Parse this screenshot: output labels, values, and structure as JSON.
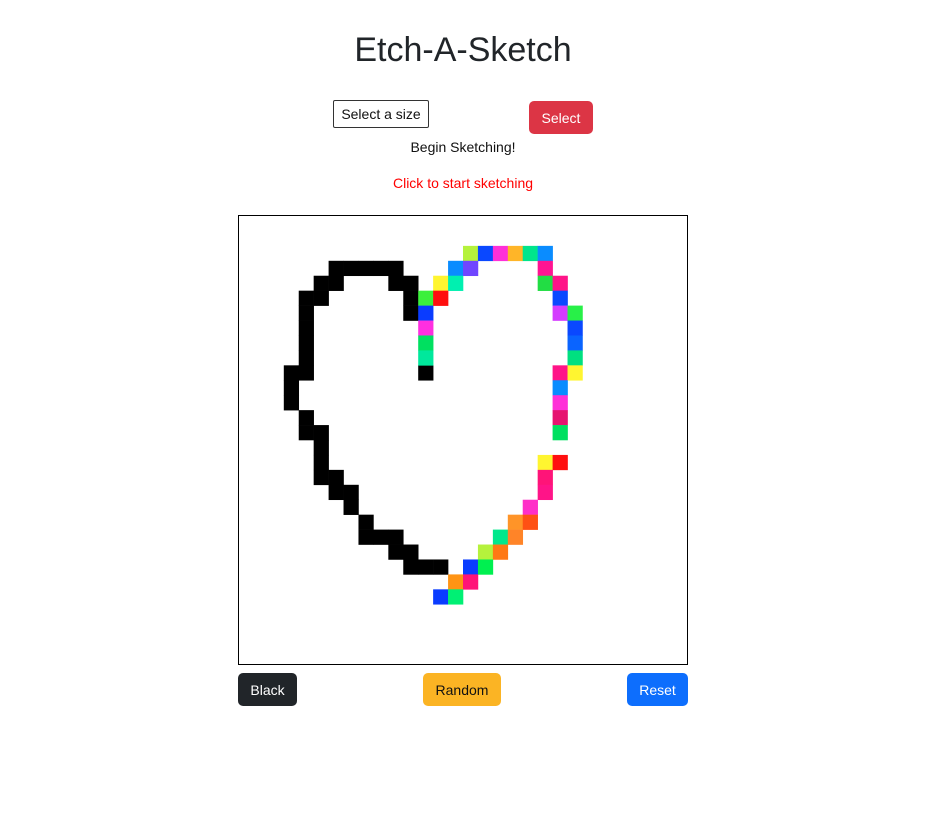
{
  "title": "Etch-A-Sketch",
  "controls": {
    "size_select_label": "Select a size",
    "select_button": "Select"
  },
  "status": "Begin Sketching!",
  "hint": "Click to start sketching",
  "hint_color": "#ff0000",
  "buttons": {
    "black": "Black",
    "random": "Random",
    "reset": "Reset"
  },
  "button_colors": {
    "select": "#dc3545",
    "black": "#212529",
    "random": "#fbb424",
    "reset": "#0d6efd"
  },
  "sketch": {
    "cells_per_side": 30,
    "black_cells": [
      [
        6,
        3
      ],
      [
        7,
        3
      ],
      [
        8,
        3
      ],
      [
        9,
        3
      ],
      [
        10,
        3
      ],
      [
        5,
        4
      ],
      [
        6,
        4
      ],
      [
        10,
        4
      ],
      [
        11,
        4
      ],
      [
        4,
        5
      ],
      [
        5,
        5
      ],
      [
        11,
        5
      ],
      [
        4,
        6
      ],
      [
        11,
        6
      ],
      [
        4,
        7
      ],
      [
        4,
        8
      ],
      [
        4,
        9
      ],
      [
        3,
        10
      ],
      [
        4,
        10
      ],
      [
        3,
        11
      ],
      [
        3,
        12
      ],
      [
        4,
        13
      ],
      [
        4,
        14
      ],
      [
        5,
        14
      ],
      [
        5,
        15
      ],
      [
        5,
        16
      ],
      [
        5,
        17
      ],
      [
        6,
        17
      ],
      [
        6,
        18
      ],
      [
        7,
        18
      ],
      [
        7,
        19
      ],
      [
        8,
        20
      ],
      [
        8,
        21
      ],
      [
        9,
        21
      ],
      [
        10,
        21
      ],
      [
        10,
        22
      ],
      [
        11,
        22
      ],
      [
        11,
        23
      ],
      [
        12,
        23
      ],
      [
        13,
        23
      ],
      [
        12,
        10
      ]
    ],
    "colored_cells": [
      {
        "c": 15,
        "r": 2,
        "color": "#b5f23c"
      },
      {
        "c": 16,
        "r": 2,
        "color": "#0a48ff"
      },
      {
        "c": 17,
        "r": 2,
        "color": "#ff2fd8"
      },
      {
        "c": 18,
        "r": 2,
        "color": "#ffb528"
      },
      {
        "c": 19,
        "r": 2,
        "color": "#00e58c"
      },
      {
        "c": 20,
        "r": 2,
        "color": "#0a8cff"
      },
      {
        "c": 14,
        "r": 3,
        "color": "#0a8cff"
      },
      {
        "c": 15,
        "r": 3,
        "color": "#7045ff"
      },
      {
        "c": 20,
        "r": 3,
        "color": "#ff1492"
      },
      {
        "c": 13,
        "r": 4,
        "color": "#fff530"
      },
      {
        "c": 14,
        "r": 4,
        "color": "#00f0b0"
      },
      {
        "c": 20,
        "r": 4,
        "color": "#22dd44"
      },
      {
        "c": 21,
        "r": 4,
        "color": "#ff1488"
      },
      {
        "c": 12,
        "r": 5,
        "color": "#3cf03c"
      },
      {
        "c": 13,
        "r": 5,
        "color": "#ff0f0f"
      },
      {
        "c": 21,
        "r": 5,
        "color": "#0a48ff"
      },
      {
        "c": 12,
        "r": 6,
        "color": "#0a3cff"
      },
      {
        "c": 21,
        "r": 6,
        "color": "#d43cff"
      },
      {
        "c": 22,
        "r": 6,
        "color": "#28f048"
      },
      {
        "c": 12,
        "r": 7,
        "color": "#ff2fe0"
      },
      {
        "c": 22,
        "r": 7,
        "color": "#0a48ff"
      },
      {
        "c": 12,
        "r": 8,
        "color": "#00e060"
      },
      {
        "c": 22,
        "r": 8,
        "color": "#0a64ff"
      },
      {
        "c": 12,
        "r": 9,
        "color": "#00e89c"
      },
      {
        "c": 22,
        "r": 9,
        "color": "#00e080"
      },
      {
        "c": 21,
        "r": 10,
        "color": "#ff1488"
      },
      {
        "c": 22,
        "r": 10,
        "color": "#fff530"
      },
      {
        "c": 21,
        "r": 11,
        "color": "#0a8cff"
      },
      {
        "c": 21,
        "r": 12,
        "color": "#ff2fd8"
      },
      {
        "c": 21,
        "r": 13,
        "color": "#e61470"
      },
      {
        "c": 21,
        "r": 14,
        "color": "#00e060"
      },
      {
        "c": 20,
        "r": 16,
        "color": "#fff530"
      },
      {
        "c": 21,
        "r": 16,
        "color": "#ff0f0f"
      },
      {
        "c": 20,
        "r": 17,
        "color": "#ff1478"
      },
      {
        "c": 20,
        "r": 18,
        "color": "#ff1488"
      },
      {
        "c": 19,
        "r": 19,
        "color": "#ff2fc8"
      },
      {
        "c": 18,
        "r": 20,
        "color": "#ff9428"
      },
      {
        "c": 19,
        "r": 20,
        "color": "#ff5014"
      },
      {
        "c": 17,
        "r": 21,
        "color": "#00e88c"
      },
      {
        "c": 18,
        "r": 21,
        "color": "#ff8428"
      },
      {
        "c": 16,
        "r": 22,
        "color": "#b5f23c"
      },
      {
        "c": 17,
        "r": 22,
        "color": "#ff7814"
      },
      {
        "c": 15,
        "r": 23,
        "color": "#0a3cff"
      },
      {
        "c": 16,
        "r": 23,
        "color": "#00f050"
      },
      {
        "c": 14,
        "r": 24,
        "color": "#ff9414"
      },
      {
        "c": 15,
        "r": 24,
        "color": "#ff1478"
      },
      {
        "c": 13,
        "r": 25,
        "color": "#0a3cff"
      },
      {
        "c": 14,
        "r": 25,
        "color": "#00f074"
      }
    ]
  }
}
